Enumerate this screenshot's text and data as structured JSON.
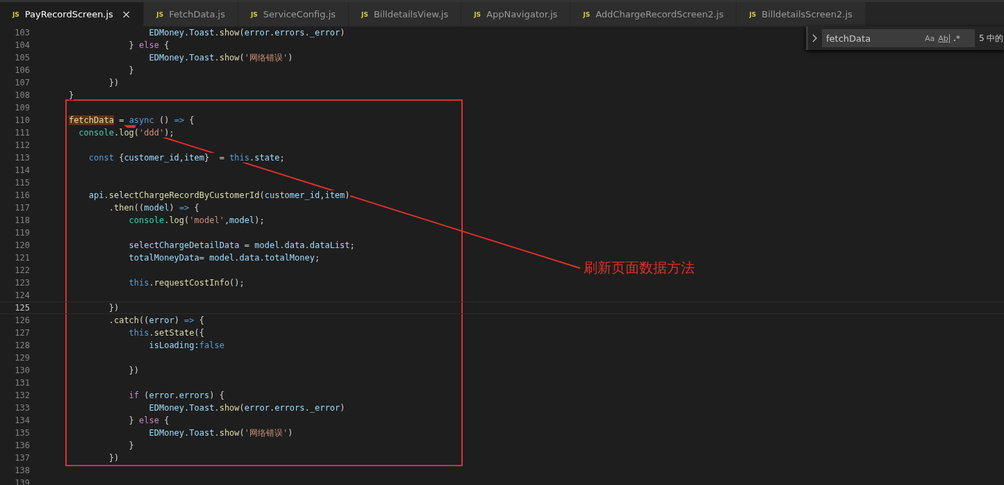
{
  "tabs": [
    {
      "badge": "JS",
      "label": "PayRecordScreen.js",
      "selected": true,
      "close": "×"
    },
    {
      "badge": "JS",
      "label": "FetchData.js",
      "selected": false
    },
    {
      "badge": "JS",
      "label": "ServiceConfig.js",
      "selected": false
    },
    {
      "badge": "JS",
      "label": "BilldetailsView.js",
      "selected": false
    },
    {
      "badge": "JS",
      "label": "AppNavigator.js",
      "selected": false
    },
    {
      "badge": "JS",
      "label": "AddChargeRecordScreen2.js",
      "selected": false
    },
    {
      "badge": "JS",
      "label": "BilldetailsScreen2.js",
      "selected": false
    }
  ],
  "find_widget": {
    "value": "fetchData",
    "options": [
      {
        "text": "Aa",
        "kind": "case"
      },
      {
        "text": "Ab",
        "kind": "word"
      },
      {
        "text": ".*",
        "kind": "regex"
      }
    ],
    "count": "5 中的"
  },
  "lines": [
    {
      "number": "103",
      "current": false,
      "tokens": [
        {
          "text": "                    EDMoney",
          "kind": "var"
        },
        {
          "text": ".",
          "kind": "p"
        },
        {
          "text": "Toast",
          "kind": "var"
        },
        {
          "text": ".",
          "kind": "p"
        },
        {
          "text": "show",
          "kind": "fn"
        },
        {
          "text": "(",
          "kind": "p"
        },
        {
          "text": "error",
          "kind": "var"
        },
        {
          "text": ".",
          "kind": "p"
        },
        {
          "text": "errors",
          "kind": "var"
        },
        {
          "text": ".",
          "kind": "p"
        },
        {
          "text": "_error",
          "kind": "var"
        },
        {
          "text": ")",
          "kind": "p"
        }
      ]
    },
    {
      "number": "104",
      "current": false,
      "tokens": [
        {
          "text": "                } ",
          "kind": "p"
        },
        {
          "text": "else",
          "kind": "ctl"
        },
        {
          "text": " {",
          "kind": "p"
        }
      ]
    },
    {
      "number": "105",
      "current": false,
      "tokens": [
        {
          "text": "                    EDMoney",
          "kind": "var"
        },
        {
          "text": ".",
          "kind": "p"
        },
        {
          "text": "Toast",
          "kind": "var"
        },
        {
          "text": ".",
          "kind": "p"
        },
        {
          "text": "show",
          "kind": "fn"
        },
        {
          "text": "(",
          "kind": "p"
        },
        {
          "text": "'网络错误'",
          "kind": "str"
        },
        {
          "text": ")",
          "kind": "p"
        }
      ]
    },
    {
      "number": "106",
      "current": false,
      "tokens": [
        {
          "text": "                }",
          "kind": "p"
        }
      ]
    },
    {
      "number": "107",
      "current": false,
      "tokens": [
        {
          "text": "            })",
          "kind": "p"
        }
      ]
    },
    {
      "number": "108",
      "current": false,
      "tokens": [
        {
          "text": "    }",
          "kind": "p"
        }
      ]
    },
    {
      "number": "109",
      "current": false
    },
    {
      "number": "110",
      "current": false,
      "tokens": [
        {
          "text": "    fetchData",
          "kind": "match"
        },
        {
          "text": " = ",
          "kind": "p"
        },
        {
          "text": "async",
          "kind": "kw"
        },
        {
          "text": " () ",
          "kind": "p"
        },
        {
          "text": "=>",
          "kind": "kw"
        },
        {
          "text": " {",
          "kind": "p"
        }
      ]
    },
    {
      "number": "111",
      "current": false,
      "tokens": [
        {
          "text": "      console",
          "kind": "cls"
        },
        {
          "text": ".log",
          "kind": "fn"
        },
        {
          "text": "(",
          "kind": "p"
        },
        {
          "text": "'ddd'",
          "kind": "str"
        },
        {
          "text": ");",
          "kind": "p"
        }
      ]
    },
    {
      "number": "112",
      "current": false
    },
    {
      "number": "113",
      "current": false,
      "tokens": [
        {
          "text": "        const",
          "kind": "kw"
        },
        {
          "text": " {",
          "kind": "p"
        },
        {
          "text": "customer_id",
          "kind": "var"
        },
        {
          "text": ",",
          "kind": "p"
        },
        {
          "text": "item",
          "kind": "var"
        },
        {
          "text": "}  = ",
          "kind": "p"
        },
        {
          "text": "this",
          "kind": "kw"
        },
        {
          "text": ".",
          "kind": "p"
        },
        {
          "text": "state",
          "kind": "var"
        },
        {
          "text": ";",
          "kind": "p"
        }
      ]
    },
    {
      "number": "114",
      "current": false
    },
    {
      "number": "115",
      "current": false
    },
    {
      "number": "116",
      "current": false,
      "tokens": [
        {
          "text": "        api",
          "kind": "var"
        },
        {
          "text": ".",
          "kind": "p"
        },
        {
          "text": "selectChargeRecordByCustomerId",
          "kind": "fn"
        },
        {
          "text": "(",
          "kind": "p"
        },
        {
          "text": "customer_id",
          "kind": "var"
        },
        {
          "text": ",",
          "kind": "p"
        },
        {
          "text": "item",
          "kind": "var"
        },
        {
          "text": ")",
          "kind": "p"
        }
      ]
    },
    {
      "number": "117",
      "current": false,
      "tokens": [
        {
          "text": "            .",
          "kind": "p"
        },
        {
          "text": "then",
          "kind": "fn"
        },
        {
          "text": "((",
          "kind": "p"
        },
        {
          "text": "model",
          "kind": "var"
        },
        {
          "text": ") ",
          "kind": "p"
        },
        {
          "text": "=>",
          "kind": "kw"
        },
        {
          "text": " {",
          "kind": "p"
        }
      ]
    },
    {
      "number": "118",
      "current": false,
      "tokens": [
        {
          "text": "                console",
          "kind": "cls"
        },
        {
          "text": ".log",
          "kind": "fn"
        },
        {
          "text": "(",
          "kind": "p"
        },
        {
          "text": "'model'",
          "kind": "str"
        },
        {
          "text": ",model",
          "kind": "var"
        },
        {
          "text": ");",
          "kind": "p"
        }
      ]
    },
    {
      "number": "119",
      "current": false
    },
    {
      "number": "120",
      "current": false,
      "tokens": [
        {
          "text": "                selectChargeDetailData",
          "kind": "var"
        },
        {
          "text": " = ",
          "kind": "p"
        },
        {
          "text": "model",
          "kind": "var"
        },
        {
          "text": ".",
          "kind": "p"
        },
        {
          "text": "data",
          "kind": "var"
        },
        {
          "text": ".",
          "kind": "p"
        },
        {
          "text": "dataList",
          "kind": "var"
        },
        {
          "text": ";",
          "kind": "p"
        }
      ]
    },
    {
      "number": "121",
      "current": false,
      "tokens": [
        {
          "text": "                totalMoneyData",
          "kind": "var"
        },
        {
          "text": "= ",
          "kind": "p"
        },
        {
          "text": "model",
          "kind": "var"
        },
        {
          "text": ".",
          "kind": "p"
        },
        {
          "text": "data",
          "kind": "var"
        },
        {
          "text": ".",
          "kind": "p"
        },
        {
          "text": "totalMoney",
          "kind": "var"
        },
        {
          "text": ";",
          "kind": "p"
        }
      ]
    },
    {
      "number": "122",
      "current": false
    },
    {
      "number": "123",
      "current": false,
      "tokens": [
        {
          "text": "                this",
          "kind": "kw"
        },
        {
          "text": ".",
          "kind": "p"
        },
        {
          "text": "requestCostInfo",
          "kind": "fn"
        },
        {
          "text": "();",
          "kind": "p"
        }
      ]
    },
    {
      "number": "124",
      "current": false
    },
    {
      "number": "125",
      "current": true,
      "tokens": [
        {
          "text": "            })",
          "kind": "p"
        }
      ]
    },
    {
      "number": "126",
      "current": false,
      "tokens": [
        {
          "text": "            .",
          "kind": "p"
        },
        {
          "text": "catch",
          "kind": "fn"
        },
        {
          "text": "((",
          "kind": "p"
        },
        {
          "text": "error",
          "kind": "var"
        },
        {
          "text": ") ",
          "kind": "p"
        },
        {
          "text": "=>",
          "kind": "kw"
        },
        {
          "text": " {",
          "kind": "p"
        }
      ]
    },
    {
      "number": "127",
      "current": false,
      "tokens": [
        {
          "text": "                this",
          "kind": "kw"
        },
        {
          "text": ".",
          "kind": "p"
        },
        {
          "text": "setState",
          "kind": "fn"
        },
        {
          "text": "({",
          "kind": "p"
        }
      ]
    },
    {
      "number": "128",
      "current": false,
      "tokens": [
        {
          "text": "                    isLoading",
          "kind": "var"
        },
        {
          "text": ":",
          "kind": "p"
        },
        {
          "text": "false",
          "kind": "kw"
        }
      ]
    },
    {
      "number": "129",
      "current": false
    },
    {
      "number": "130",
      "current": false,
      "tokens": [
        {
          "text": "                })",
          "kind": "p"
        }
      ]
    },
    {
      "number": "131",
      "current": false
    },
    {
      "number": "132",
      "current": false,
      "tokens": [
        {
          "text": "                if",
          "kind": "ctl"
        },
        {
          "text": " (",
          "kind": "p"
        },
        {
          "text": "error",
          "kind": "var"
        },
        {
          "text": ".",
          "kind": "p"
        },
        {
          "text": "errors",
          "kind": "var"
        },
        {
          "text": ") {",
          "kind": "p"
        }
      ]
    },
    {
      "number": "133",
      "current": false,
      "tokens": [
        {
          "text": "                    EDMoney",
          "kind": "var"
        },
        {
          "text": ".",
          "kind": "p"
        },
        {
          "text": "Toast",
          "kind": "var"
        },
        {
          "text": ".",
          "kind": "p"
        },
        {
          "text": "show",
          "kind": "fn"
        },
        {
          "text": "(",
          "kind": "p"
        },
        {
          "text": "error",
          "kind": "var"
        },
        {
          "text": ".",
          "kind": "p"
        },
        {
          "text": "errors",
          "kind": "var"
        },
        {
          "text": ".",
          "kind": "p"
        },
        {
          "text": "_error",
          "kind": "var"
        },
        {
          "text": ")",
          "kind": "p"
        }
      ]
    },
    {
      "number": "134",
      "current": false,
      "tokens": [
        {
          "text": "                } ",
          "kind": "p"
        },
        {
          "text": "else",
          "kind": "ctl"
        },
        {
          "text": " {",
          "kind": "p"
        }
      ]
    },
    {
      "number": "135",
      "current": false,
      "tokens": [
        {
          "text": "                    EDMoney",
          "kind": "var"
        },
        {
          "text": ".",
          "kind": "p"
        },
        {
          "text": "Toast",
          "kind": "var"
        },
        {
          "text": ".",
          "kind": "p"
        },
        {
          "text": "show",
          "kind": "fn"
        },
        {
          "text": "(",
          "kind": "p"
        },
        {
          "text": "'网络错误'",
          "kind": "str"
        },
        {
          "text": ")",
          "kind": "p"
        }
      ]
    },
    {
      "number": "136",
      "current": false,
      "tokens": [
        {
          "text": "                }",
          "kind": "p"
        }
      ]
    },
    {
      "number": "137",
      "current": false,
      "tokens": [
        {
          "text": "            })",
          "kind": "p"
        }
      ]
    },
    {
      "number": "138",
      "current": false
    },
    {
      "number": "139",
      "current": false
    }
  ],
  "annotation": {
    "label": "刷新页面数据方法"
  }
}
